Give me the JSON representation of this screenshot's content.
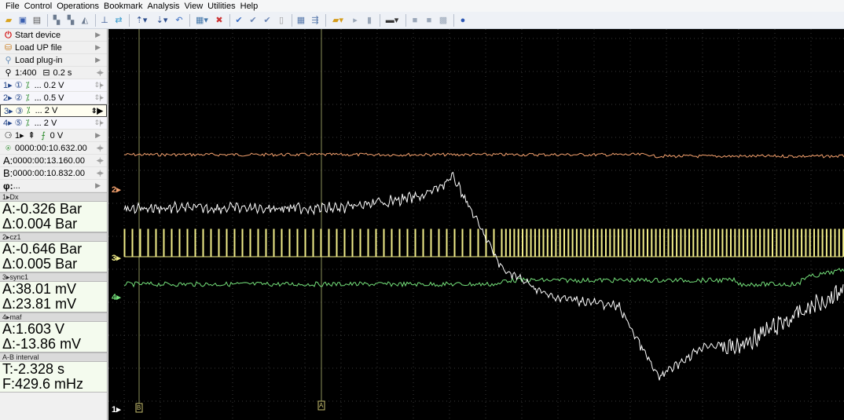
{
  "menu": [
    "File",
    "Control",
    "Operations",
    "Bookmark",
    "Analysis",
    "View",
    "Utilities",
    "Help"
  ],
  "toolbar_icons": [
    "open-icon",
    "save-icon",
    "print-icon",
    "sep",
    "layout1-icon",
    "layout2-icon",
    "layout3-icon",
    "sep",
    "trigger-icon",
    "cursor-icon",
    "sep",
    "channel-add-icon",
    "channel-math-icon",
    "undo-icon",
    "sep",
    "math-icon",
    "delete-icon",
    "sep",
    "check-icon",
    "check2-icon",
    "check3-icon",
    "page-icon",
    "sep",
    "grid-icon",
    "export-icon",
    "sep",
    "record-icon",
    "play-icon",
    "stop-icon",
    "sep",
    "display-icon",
    "sep",
    "box1-icon",
    "box2-icon",
    "box3-icon",
    "sep",
    "help-icon"
  ],
  "panel": {
    "start_device": "Start device",
    "load_up": "Load UP file",
    "load_plugin": "Load plug-in",
    "zoom": "1:400",
    "timebase": "0.2 s",
    "ch1": "1▸ ①",
    "ch1_scale": "... 0.2 V",
    "ch2": "2▸ ②",
    "ch2_scale": "... 0.5 V",
    "ch3": "3▸ ③",
    "ch3_scale": "... 2 V",
    "ch4": "4▸ ⑤",
    "ch4_scale": "... 2 V",
    "trig": "1▸",
    "trig_level": "0 V",
    "time_cursor": "0000:00:10.632.00",
    "cursor_a": "0000:00:13.160.00",
    "cursor_b": "0000:00:10.832.00",
    "phi": "...",
    "icon_a": "A:",
    "icon_b": "B:",
    "icon_phi": "φ:"
  },
  "measurements": [
    {
      "head": "1▸Dx",
      "a": "A:-0.326 Bar",
      "d": "Δ:0.004 Bar"
    },
    {
      "head": "2▸cz1",
      "a": "A:-0.646 Bar",
      "d": "Δ:0.005 Bar"
    },
    {
      "head": "3▸sync1",
      "a": "A:38.01 mV",
      "d": "Δ:23.81 mV"
    },
    {
      "head": "4▸maf",
      "a": "A:1.603 V",
      "d": "Δ:-13.86 mV"
    },
    {
      "head": "A-B interval",
      "a": "T:-2.328 s",
      "d": "F:429.6 mHz"
    }
  ],
  "scope": {
    "ch_labels": [
      "2▸",
      "3▸",
      "4▸",
      "1▸"
    ],
    "cursor_b_label": "B",
    "cursor_a_label": "A",
    "colors": {
      "ch1": "#f4a16e",
      "ch2": "#ffffff",
      "ch3": "#f2ee8a",
      "ch4": "#74e07a",
      "label2": "#f4a16e",
      "label3": "#f2ee8a",
      "label4": "#74e07a",
      "label1": "#ffffff"
    }
  }
}
